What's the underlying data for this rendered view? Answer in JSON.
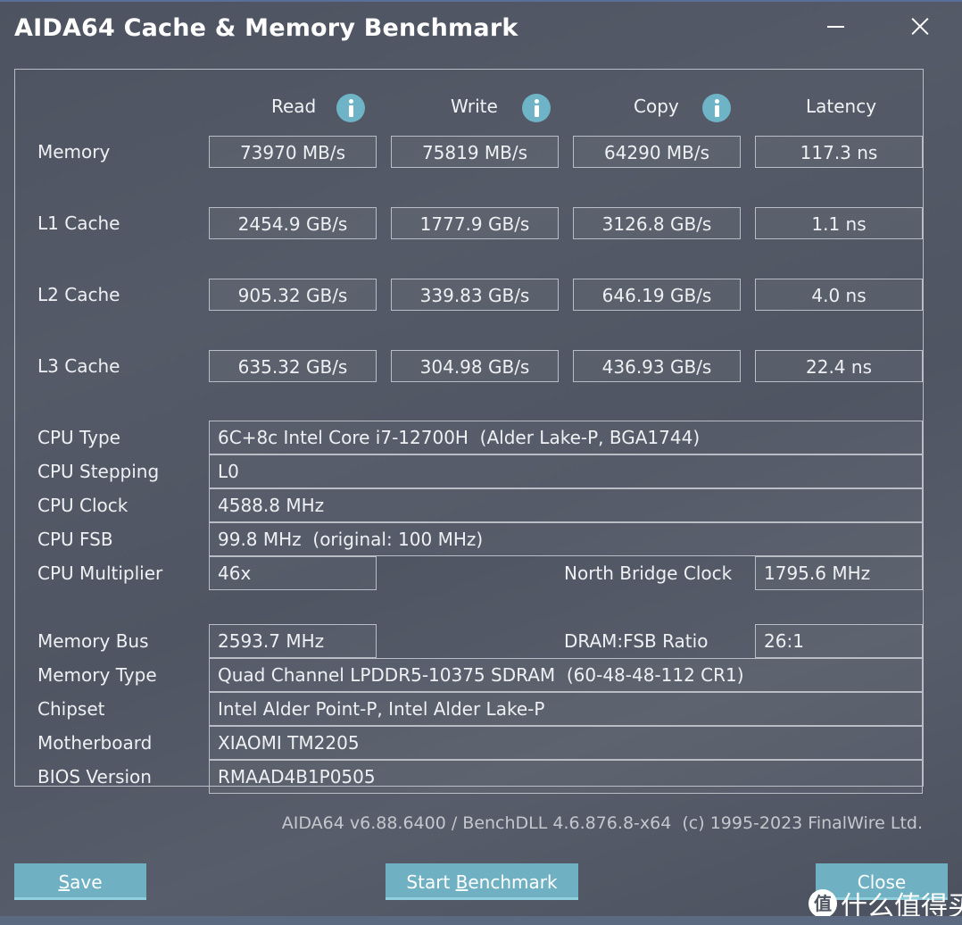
{
  "window": {
    "title": "AIDA64 Cache & Memory Benchmark",
    "minimize_icon": "minimize-icon",
    "close_icon": "close-icon"
  },
  "bench": {
    "columns": [
      {
        "label": "Read",
        "info_icon": "info-icon"
      },
      {
        "label": "Write",
        "info_icon": "info-icon"
      },
      {
        "label": "Copy",
        "info_icon": "info-icon"
      },
      {
        "label": "Latency"
      }
    ],
    "rows": [
      {
        "label": "Memory",
        "read": "73970 MB/s",
        "write": "75819 MB/s",
        "copy": "64290 MB/s",
        "latency": "117.3 ns"
      },
      {
        "label": "L1 Cache",
        "read": "2454.9 GB/s",
        "write": "1777.9 GB/s",
        "copy": "3126.8 GB/s",
        "latency": "1.1 ns"
      },
      {
        "label": "L2 Cache",
        "read": "905.32 GB/s",
        "write": "339.83 GB/s",
        "copy": "646.19 GB/s",
        "latency": "4.0 ns"
      },
      {
        "label": "L3 Cache",
        "read": "635.32 GB/s",
        "write": "304.98 GB/s",
        "copy": "436.93 GB/s",
        "latency": "22.4 ns"
      }
    ]
  },
  "cpu": {
    "type_label": "CPU Type",
    "type_value": "6C+8c Intel Core i7-12700H  (Alder Lake-P, BGA1744)",
    "stepping_label": "CPU Stepping",
    "stepping_value": "L0",
    "clock_label": "CPU Clock",
    "clock_value": "4588.8 MHz",
    "fsb_label": "CPU FSB",
    "fsb_value": "99.8 MHz  (original: 100 MHz)",
    "multiplier_label": "CPU Multiplier",
    "multiplier_value": "46x",
    "nb_clock_label": "North Bridge Clock",
    "nb_clock_value": "1795.6 MHz"
  },
  "memory": {
    "bus_label": "Memory Bus",
    "bus_value": "2593.7 MHz",
    "ratio_label": "DRAM:FSB Ratio",
    "ratio_value": "26:1",
    "type_label": "Memory Type",
    "type_value": "Quad Channel LPDDR5-10375 SDRAM  (60-48-48-112 CR1)",
    "chipset_label": "Chipset",
    "chipset_value": "Intel Alder Point-P, Intel Alder Lake-P",
    "motherboard_label": "Motherboard",
    "motherboard_value": "XIAOMI TM2205",
    "bios_label": "BIOS Version",
    "bios_value": "RMAAD4B1P0505"
  },
  "footer": {
    "version": "AIDA64 v6.88.6400 / BenchDLL 4.6.876.8-x64  (c) 1995-2023 FinalWire Ltd."
  },
  "buttons": {
    "save": {
      "mnemonic": "S",
      "rest": "ave"
    },
    "start": {
      "pre": "Start ",
      "mnemonic": "B",
      "rest": "enchmark"
    },
    "close": {
      "label": "Close"
    }
  },
  "watermark": {
    "logo_char": "值",
    "text": "什么值得买"
  },
  "colors": {
    "accent_button": "#6fb1c2",
    "info_icon": "#6fb3c6",
    "background": "#4f5562"
  }
}
